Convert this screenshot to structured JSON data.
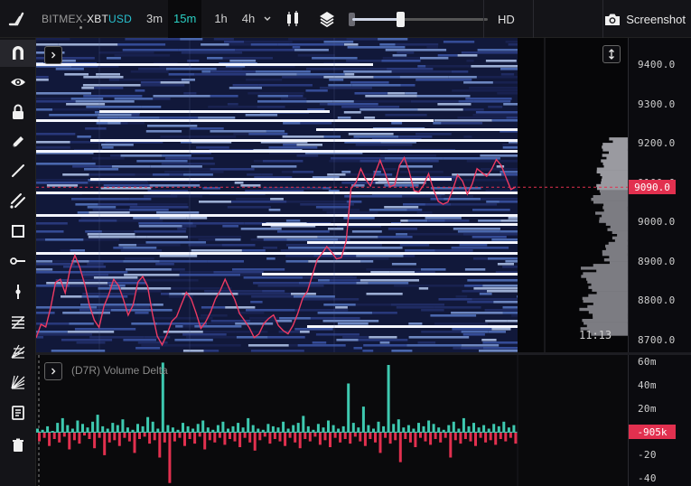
{
  "app": {
    "exchange": "BITMEX",
    "separator": "-",
    "base": "XBT",
    "quote": "USD"
  },
  "timeframes": [
    {
      "label": "3m",
      "active": false
    },
    {
      "label": "15m",
      "active": true
    },
    {
      "label": "1h",
      "active": false
    },
    {
      "label": "4h",
      "active": false
    }
  ],
  "toolbar": {
    "hd_label": "HD",
    "screenshot_label": "Screenshot",
    "contrast_fraction": 0.35
  },
  "left_tools": [
    {
      "name": "magnet-icon",
      "active": true
    },
    {
      "name": "eye-icon",
      "active": false
    },
    {
      "name": "lock-icon",
      "active": false
    },
    {
      "name": "pencil-icon",
      "active": false
    },
    {
      "name": "trend-line-icon",
      "active": false
    },
    {
      "name": "parallel-channel-icon",
      "active": false
    },
    {
      "name": "rectangle-icon",
      "active": false
    },
    {
      "name": "ray-icon",
      "active": false
    },
    {
      "name": "vertical-line-icon",
      "active": false
    },
    {
      "name": "fib-retracement-icon",
      "active": false
    },
    {
      "name": "gann-icon",
      "active": false
    },
    {
      "name": "fan-icon",
      "active": false
    },
    {
      "name": "note-icon",
      "active": false
    },
    {
      "name": "trash-icon",
      "active": false
    }
  ],
  "chart_data": [
    {
      "type": "heatmap",
      "title": "",
      "y_ticks": [
        "9400.0",
        "9300.0",
        "9200.0",
        "9100.0",
        "9000.0",
        "8900.0",
        "8800.0",
        "8700.0"
      ],
      "ylim": [
        8670,
        9470
      ],
      "current_price": "9090.0",
      "current_price_value": 9090,
      "clock": "11:13",
      "price_series": [
        8705,
        8745,
        8730,
        8790,
        8840,
        8860,
        8820,
        8880,
        8920,
        8890,
        8840,
        8790,
        8760,
        8740,
        8790,
        8820,
        8860,
        8840,
        8800,
        8760,
        8790,
        8840,
        8870,
        8830,
        8770,
        8720,
        8690,
        8710,
        8740,
        8760,
        8790,
        8820,
        8800,
        8770,
        8730,
        8740,
        8780,
        8810,
        8830,
        8850,
        8830,
        8800,
        8770,
        8750,
        8730,
        8710,
        8720,
        8740,
        8760,
        8770,
        8740,
        8720,
        8710,
        8740,
        8770,
        8800,
        8830,
        8860,
        8900,
        8920,
        8940,
        8930,
        8900,
        8920,
        8950,
        9080,
        9110,
        9130,
        9120,
        9100,
        9130,
        9150,
        9120,
        9090,
        9100,
        9140,
        9170,
        9130,
        9080,
        9070,
        9100,
        9120,
        9090,
        9060,
        9040,
        9050,
        9080,
        9120,
        9100,
        9070,
        9100,
        9140,
        9130,
        9110,
        9130,
        9160,
        9140,
        9110,
        9080,
        9090
      ]
    },
    {
      "type": "bar",
      "title": "(D7R) Volume Delta",
      "y_ticks": [
        "60m",
        "40m",
        "20m",
        "-20",
        "-40"
      ],
      "ylim": [
        -45,
        65
      ],
      "current_value_label": "-905k",
      "values": [
        3,
        2,
        5,
        1,
        8,
        12,
        6,
        3,
        10,
        7,
        4,
        9,
        15,
        5,
        3,
        8,
        6,
        11,
        4,
        2,
        7,
        5,
        13,
        9,
        3,
        60,
        6,
        4,
        2,
        8,
        5,
        3,
        7,
        10,
        4,
        2,
        6,
        9,
        3,
        5,
        8,
        4,
        12,
        6,
        3,
        2,
        7,
        5,
        4,
        9,
        3,
        6,
        8,
        14,
        5,
        2,
        7,
        4,
        10,
        6,
        3,
        5,
        42,
        8,
        4,
        22,
        6,
        3,
        9,
        5,
        58,
        7,
        11,
        4,
        6,
        3,
        8,
        5,
        10,
        7,
        4,
        2,
        6,
        9,
        3,
        12,
        5,
        8,
        4,
        6,
        3,
        7,
        5,
        9,
        4,
        6
      ],
      "neg_values": [
        -8,
        -5,
        -12,
        -6,
        -9,
        -4,
        -15,
        -7,
        -10,
        -3,
        -6,
        -14,
        -5,
        -20,
        -9,
        -7,
        -12,
        -5,
        -8,
        -18,
        -6,
        -4,
        -10,
        -7,
        -22,
        -9,
        -44,
        -8,
        -5,
        -12,
        -6,
        -10,
        -4,
        -15,
        -7,
        -9,
        -5,
        -11,
        -6,
        -8,
        -13,
        -5,
        -9,
        -16,
        -7,
        -4,
        -10,
        -6,
        -8,
        -12,
        -5,
        -9,
        -14,
        -6,
        -8,
        -4,
        -11,
        -7,
        -13,
        -5,
        -9,
        -6,
        -10,
        -4,
        -8,
        -12,
        -6,
        -9,
        -18,
        -5,
        -10,
        -7,
        -26,
        -6,
        -9,
        -13,
        -5,
        -8,
        -11,
        -6,
        -9,
        -5,
        -22,
        -7,
        -10,
        -6,
        -8,
        -12,
        -5,
        -9,
        -7,
        -11,
        -6,
        -8,
        -5,
        -10
      ]
    }
  ],
  "colors": {
    "accent_teal": "#2ad0c4",
    "price_red": "#e2304f",
    "positive": "#3ec9b0",
    "negative": "#e2304f"
  }
}
